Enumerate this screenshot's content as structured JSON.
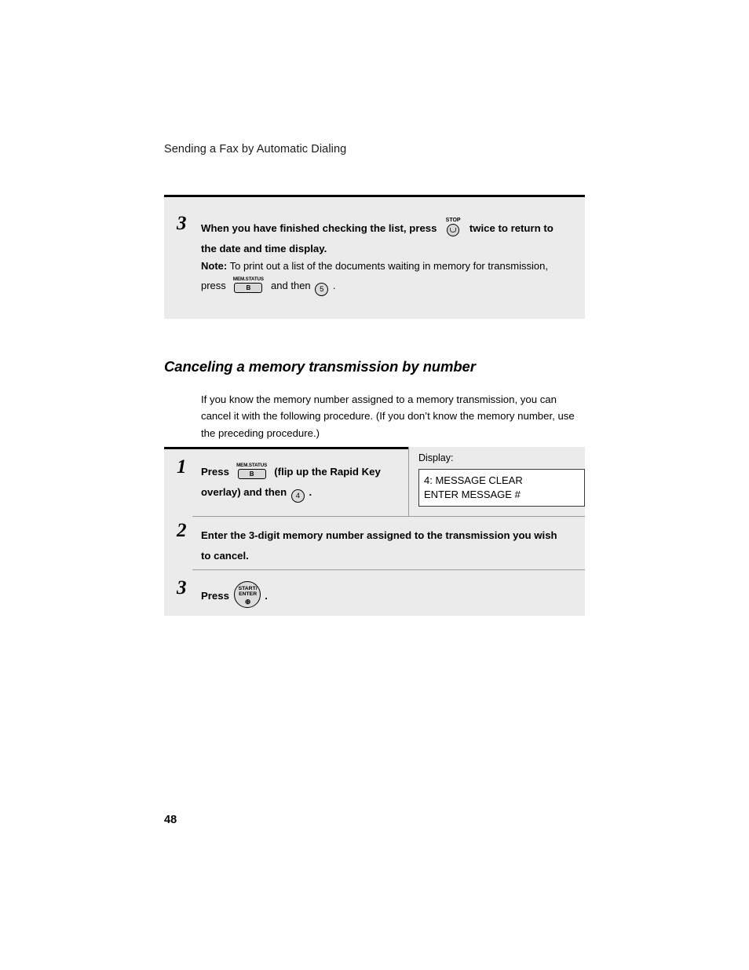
{
  "document": {
    "running_head": "Sending a Fax by Automatic Dialing",
    "page_number": "48"
  },
  "step_3_top": {
    "number": "3",
    "line1_a": "When you have finished checking the list, press",
    "key_stop": {
      "label": "STOP",
      "icon": "stop-key-icon"
    },
    "line1_b": "twice to return to",
    "line2": "the date and time display.",
    "note_label": "Note:",
    "note_text": "To print out a list of the documents waiting in memory for transmission,",
    "note_press": "press",
    "key_memstatus": {
      "label": "MEM.STATUS",
      "button": "B"
    },
    "note_and_then": "and then",
    "key_digit": "5",
    "note_end": "."
  },
  "section": {
    "heading": "Canceling a memory transmission by number",
    "paragraph": "If you know the memory number assigned to a memory transmission, you can cancel it with the following procedure. (If you don’t know the memory number, use the preceding procedure.)"
  },
  "step_1": {
    "number": "1",
    "press_label": "Press",
    "key_memstatus": {
      "label": "MEM.STATUS",
      "button": "B"
    },
    "text_a": "(flip up the Rapid Key",
    "text_b": "overlay) and then",
    "key_digit": "4",
    "text_end": ".",
    "display": {
      "label": "Display:",
      "line1": "4: MESSAGE CLEAR",
      "line2": "ENTER MESSAGE #"
    }
  },
  "step_2": {
    "number": "2",
    "line1": "Enter the 3-digit memory number assigned to the transmission you wish",
    "line2": "to cancel."
  },
  "step_3_bottom": {
    "number": "3",
    "press_label": "Press",
    "key_start_enter": {
      "line1": "START/",
      "line2": "ENTER",
      "line3": "⊕"
    },
    "text_end": "."
  },
  "colors": {
    "box_bg": "#ebebeb",
    "rule_dark": "#000000",
    "rule_light": "#9a9a9a",
    "key_fill": "#dcdcdc"
  }
}
